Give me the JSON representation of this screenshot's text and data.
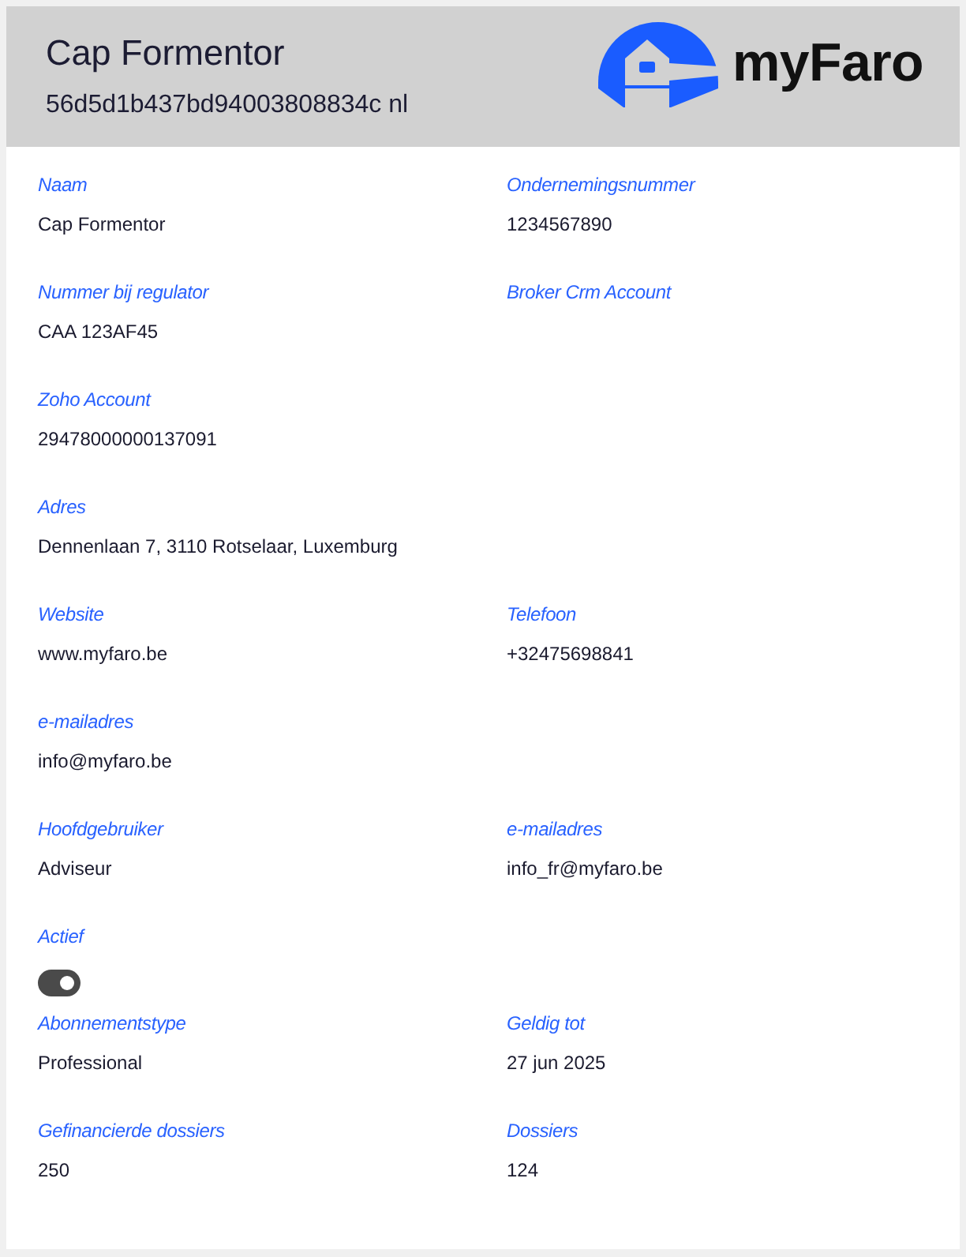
{
  "header": {
    "title": "Cap Formentor",
    "subtitle": "56d5d1b437bd94003808834c nl",
    "logo": {
      "text": "myFaro"
    }
  },
  "rows": [
    [
      {
        "kind": "text",
        "label": "Naam",
        "value": "Cap Formentor"
      },
      {
        "kind": "text",
        "label": "Ondernemingsnummer",
        "value": "1234567890"
      }
    ],
    [
      {
        "kind": "text",
        "label": "Nummer bij regulator",
        "value": "CAA 123AF45"
      },
      {
        "kind": "text",
        "label": "Broker Crm Account"
      }
    ],
    [
      {
        "kind": "text",
        "label": "Zoho Account",
        "value": "29478000000137091"
      }
    ],
    [
      {
        "kind": "text",
        "label": "Adres",
        "value": "Dennenlaan 7, 3110 Rotselaar, Luxemburg"
      }
    ],
    [
      {
        "kind": "text",
        "label": "Website",
        "value": "www.myfaro.be"
      },
      {
        "kind": "text",
        "label": "Telefoon",
        "value": "+32475698841"
      }
    ],
    [
      {
        "kind": "text",
        "label": "e-mailadres",
        "value": "info@myfaro.be"
      }
    ],
    [
      {
        "kind": "text",
        "label": "Hoofdgebruiker",
        "value": "Adviseur"
      },
      {
        "kind": "text",
        "label": "e-mailadres",
        "value": "info_fr@myfaro.be"
      }
    ],
    [
      {
        "kind": "toggle",
        "label": "Actief",
        "on": true
      }
    ],
    [
      {
        "kind": "text",
        "label": "Abonnementstype",
        "value": "Professional"
      },
      {
        "kind": "text",
        "label": "Geldig tot",
        "value": "27 jun 2025"
      }
    ],
    [
      {
        "kind": "text",
        "label": "Gefinancierde dossiers",
        "value": "250"
      },
      {
        "kind": "text",
        "label": "Dossiers",
        "value": "124"
      }
    ]
  ]
}
